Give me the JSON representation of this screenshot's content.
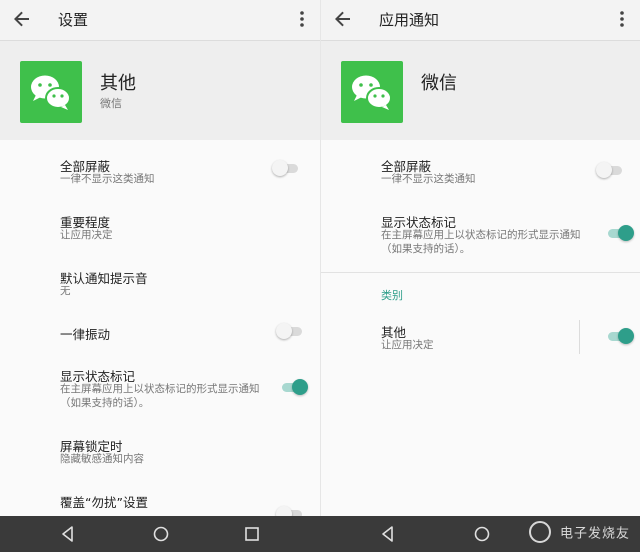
{
  "left": {
    "appbar": {
      "title": "设置"
    },
    "header": {
      "app_name": "其他",
      "app_sub": "微信"
    },
    "rows": [
      {
        "title": "全部屏蔽",
        "summary": "一律不显示这类通知",
        "toggle": false
      },
      {
        "title": "重要程度",
        "summary": "让应用决定"
      },
      {
        "title": "默认通知提示音",
        "summary": "无"
      },
      {
        "title": "一律振动",
        "toggle": false
      },
      {
        "title": "显示状态标记",
        "summary": "在主屏幕应用上以状态标记的形式显示通知（如果支持的话）。",
        "toggle": true
      },
      {
        "title": "屏幕锁定时",
        "summary": "隐藏敏感通知内容"
      },
      {
        "title": "覆盖“勿扰”设置",
        "toggle": false
      }
    ]
  },
  "right": {
    "appbar": {
      "title": "应用通知"
    },
    "header": {
      "app_name": "微信"
    },
    "rows": [
      {
        "title": "全部屏蔽",
        "summary": "一律不显示这类通知",
        "toggle": false
      },
      {
        "title": "显示状态标记",
        "summary": "在主屏幕应用上以状态标记的形式显示通知（如果支持的话）。",
        "toggle": true
      }
    ],
    "category_label": "类别",
    "category_row": {
      "title": "其他",
      "summary": "让应用决定",
      "toggle": true
    }
  },
  "watermark": {
    "text": "电子发烧友"
  },
  "colors": {
    "accent": "#2e9e8a",
    "wechat_green": "#3fc04b"
  },
  "icons": [
    "back-arrow-icon",
    "more-vert-icon",
    "wechat-icon",
    "nav-back-icon",
    "nav-home-icon",
    "nav-recents-icon"
  ]
}
